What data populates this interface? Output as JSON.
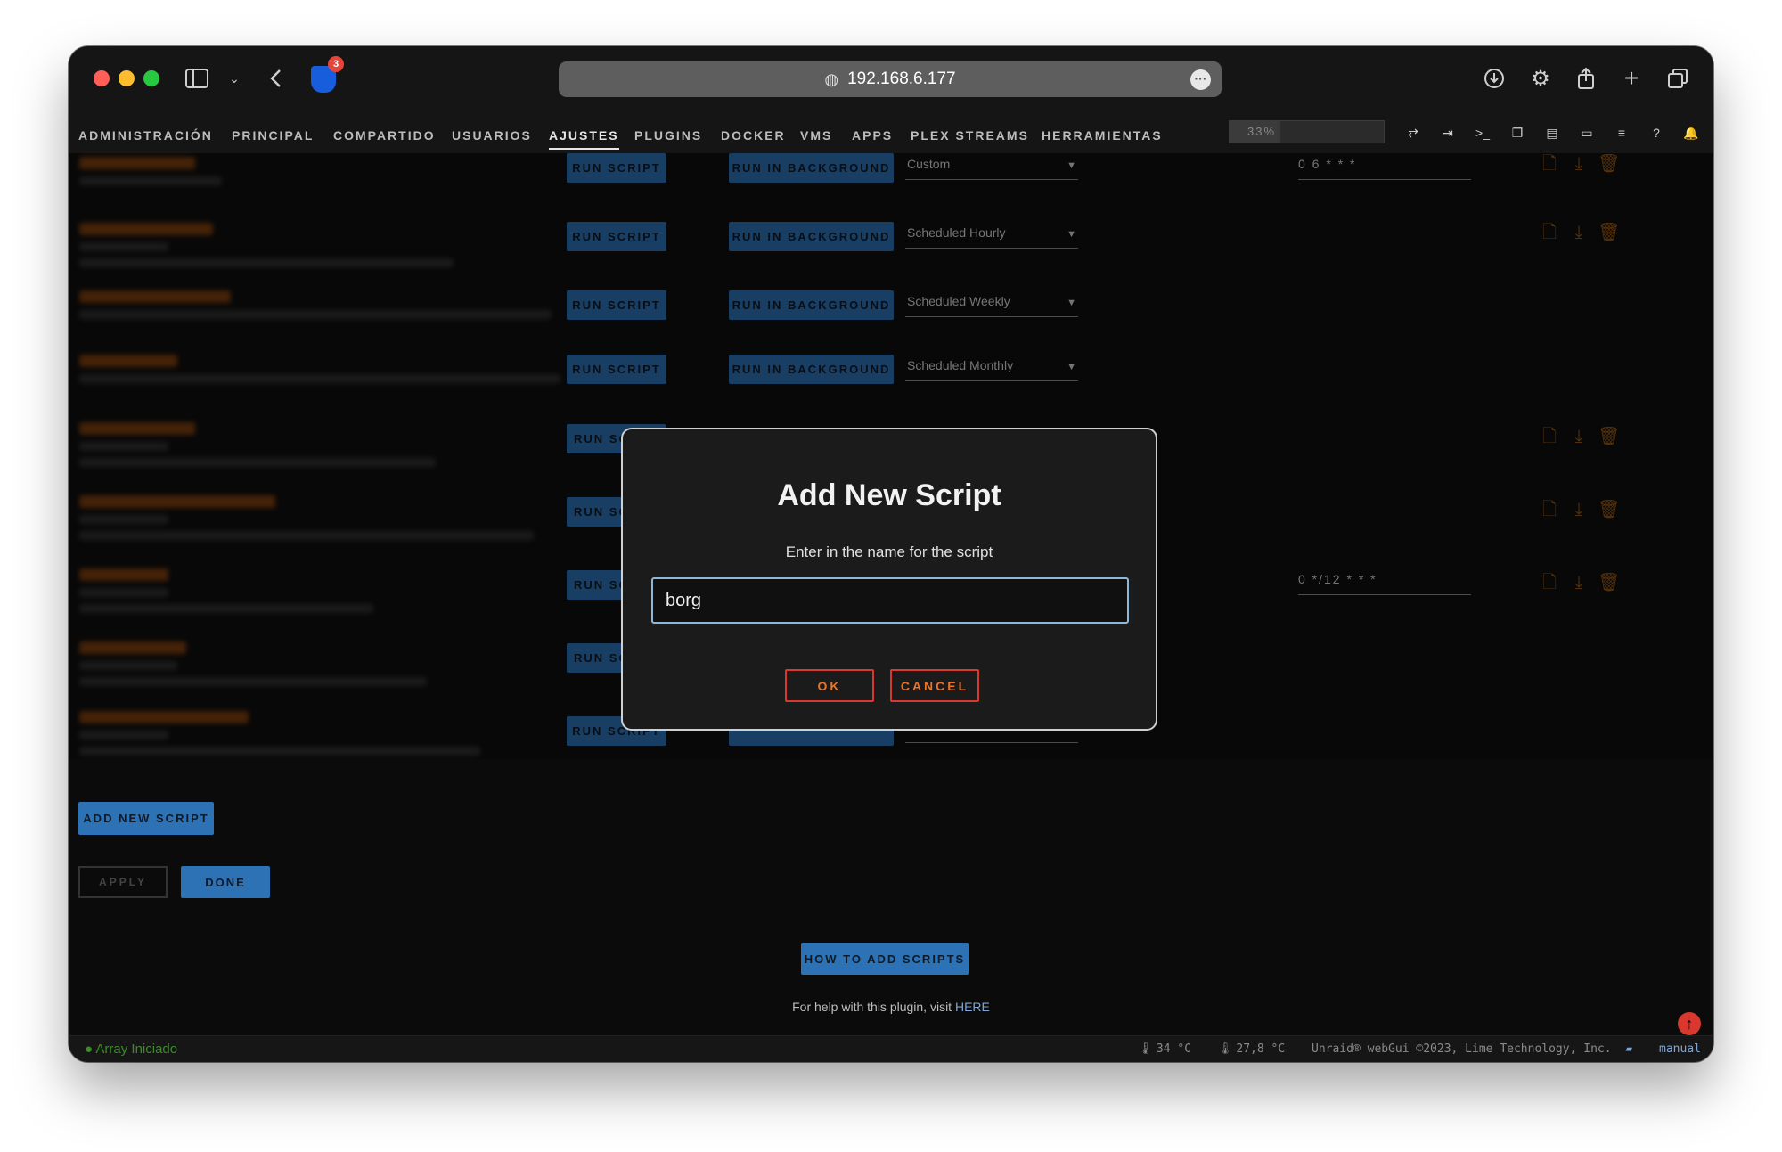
{
  "browser": {
    "address": "192.168.6.177",
    "extension_badge": "3"
  },
  "nav": {
    "items": [
      "ADMINISTRACIÓN",
      "PRINCIPAL",
      "COMPARTIDO",
      "USUARIOS",
      "AJUSTES",
      "PLUGINS",
      "DOCKER",
      "VMS",
      "APPS",
      "PLEX STREAMS",
      "HERRAMIENTAS"
    ],
    "active": "AJUSTES",
    "zoom": "33%"
  },
  "rows": [
    {
      "run": "RUN SCRIPT",
      "background": "RUN IN BACKGROUND",
      "schedule": "Custom",
      "cron": "0 6 * * *"
    },
    {
      "run": "RUN SCRIPT",
      "background": "RUN IN BACKGROUND",
      "schedule": "Scheduled Hourly",
      "cron": ""
    },
    {
      "run": "RUN SCRIPT",
      "background": "RUN IN BACKGROUND",
      "schedule": "Scheduled Weekly",
      "cron": ""
    },
    {
      "run": "RUN SCRIPT",
      "background": "RUN IN BACKGROUND",
      "schedule": "Scheduled Monthly",
      "cron": ""
    },
    {
      "run": "RUN SC",
      "background": "",
      "schedule": "",
      "cron": ""
    },
    {
      "run": "RUN SC",
      "background": "",
      "schedule": "",
      "cron": ""
    },
    {
      "run": "RUN SC",
      "background": "",
      "schedule": "",
      "cron": "0 */12 * * *"
    },
    {
      "run": "RUN SC",
      "background": "",
      "schedule": "",
      "cron": ""
    },
    {
      "run": "RUN SCRIPT",
      "background": "",
      "schedule": "",
      "cron": ""
    }
  ],
  "actions": {
    "add_new_script": "ADD NEW SCRIPT",
    "apply": "APPLY",
    "done": "DONE",
    "how_to": "HOW TO ADD SCRIPTS",
    "help_text": "For help with this plugin, visit ",
    "help_link": "HERE"
  },
  "footer": {
    "status": "Array Iniciado",
    "temp1": "34 °C",
    "temp2": "27,8 °C",
    "copyright": "Unraid® webGui ©2023, Lime Technology, Inc.",
    "manual": "manual"
  },
  "modal": {
    "title": "Add New Script",
    "message": "Enter in the name for the script",
    "input_value": "borg",
    "ok": "OK",
    "cancel": "CANCEL"
  },
  "colors": {
    "accent_blue": "#2d72b5",
    "modal_button_border": "#d63a2e",
    "modal_button_text": "#e8752a"
  }
}
